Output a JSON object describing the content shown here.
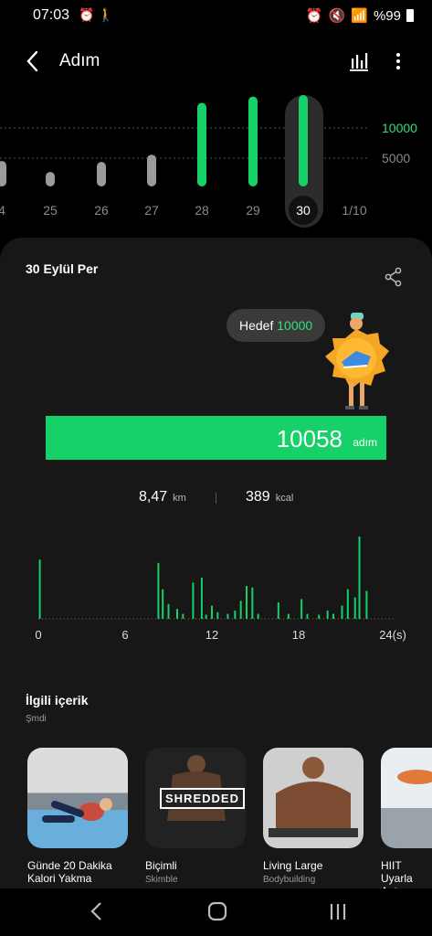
{
  "status": {
    "time": "07:03",
    "battery": "%99"
  },
  "header": {
    "title": "Adım"
  },
  "day_chart": {
    "labels": [
      "4",
      "25",
      "26",
      "27",
      "28",
      "29",
      "30",
      "1/10"
    ],
    "values": [
      2800,
      1600,
      2700,
      3500,
      9200,
      9900,
      10058,
      0
    ],
    "goal_met": [
      false,
      false,
      false,
      false,
      true,
      true,
      true,
      false
    ],
    "selected_index": 6,
    "ref_labels": [
      "10000",
      "5000"
    ]
  },
  "card": {
    "date": "30 Eylül Per",
    "goal_label": "Hedef",
    "goal_value": "10000",
    "steps": "10058",
    "steps_unit": "adım",
    "distance": "8,47",
    "distance_unit": "km",
    "calories": "389",
    "calories_unit": "kcal"
  },
  "chart_data": {
    "type": "bar",
    "x_ticks": [
      "0",
      "6",
      "12",
      "18",
      "24(s)"
    ],
    "xlim": [
      0,
      24
    ],
    "bar_color": "#16d068",
    "bars": [
      {
        "x": 0.1,
        "v": 0.72
      },
      {
        "x": 8.3,
        "v": 0.68
      },
      {
        "x": 8.6,
        "v": 0.36
      },
      {
        "x": 9.0,
        "v": 0.18
      },
      {
        "x": 9.6,
        "v": 0.12
      },
      {
        "x": 10.0,
        "v": 0.06
      },
      {
        "x": 10.7,
        "v": 0.44
      },
      {
        "x": 11.3,
        "v": 0.5
      },
      {
        "x": 11.6,
        "v": 0.05
      },
      {
        "x": 12.0,
        "v": 0.16
      },
      {
        "x": 12.4,
        "v": 0.08
      },
      {
        "x": 13.1,
        "v": 0.06
      },
      {
        "x": 13.6,
        "v": 0.1
      },
      {
        "x": 14.0,
        "v": 0.22
      },
      {
        "x": 14.4,
        "v": 0.4
      },
      {
        "x": 14.8,
        "v": 0.38
      },
      {
        "x": 15.2,
        "v": 0.06
      },
      {
        "x": 16.6,
        "v": 0.2
      },
      {
        "x": 17.3,
        "v": 0.06
      },
      {
        "x": 18.2,
        "v": 0.24
      },
      {
        "x": 18.6,
        "v": 0.06
      },
      {
        "x": 19.4,
        "v": 0.05
      },
      {
        "x": 20.0,
        "v": 0.1
      },
      {
        "x": 20.4,
        "v": 0.06
      },
      {
        "x": 21.0,
        "v": 0.16
      },
      {
        "x": 21.4,
        "v": 0.36
      },
      {
        "x": 21.9,
        "v": 0.26
      },
      {
        "x": 22.2,
        "v": 1.0
      },
      {
        "x": 22.7,
        "v": 0.34
      }
    ]
  },
  "related": {
    "title": "İlgili içerik",
    "subtitle": "Şmdi",
    "items": [
      {
        "title": "Günde 20 Dakika Kalori Yakma",
        "sub": "",
        "badge": ""
      },
      {
        "title": "Biçimli",
        "sub": "Skimble",
        "badge": "SHREDDED"
      },
      {
        "title": "Living Large",
        "sub": "Bodybuilding",
        "badge": ""
      },
      {
        "title": "HIIT Uyarla Antrenmı",
        "sub": "",
        "badge": ""
      }
    ]
  }
}
